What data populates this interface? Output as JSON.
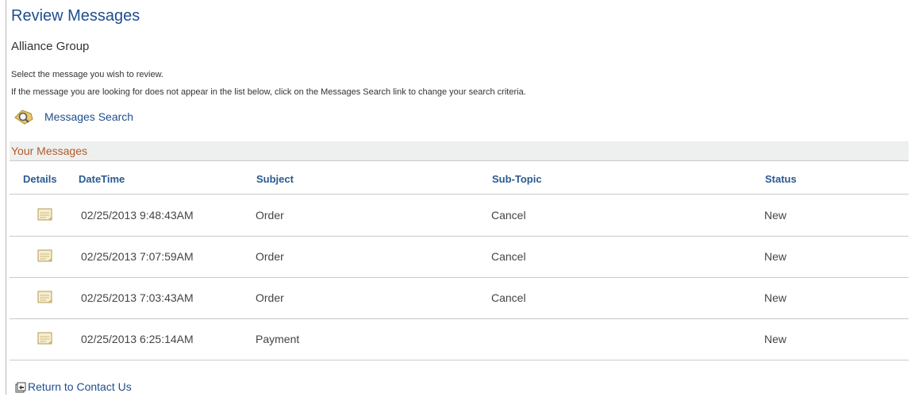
{
  "page": {
    "title": "Review Messages",
    "organization": "Alliance Group",
    "instruction_1": "Select the message you wish to review.",
    "instruction_2": "If the message you are looking for does not appear in the list below, click on the Messages Search link to change your search criteria."
  },
  "search_link": {
    "label": "Messages Search",
    "icon": "magnifier-search-icon"
  },
  "grid": {
    "title": "Your Messages",
    "columns": [
      "Details",
      "DateTime",
      "Subject",
      "Sub-Topic",
      "Status"
    ],
    "rows": [
      {
        "details_icon": "message-details-icon",
        "datetime": "02/25/2013  9:48:43AM",
        "subject": "Order",
        "sub_topic": "Cancel",
        "status": "New"
      },
      {
        "details_icon": "message-details-icon",
        "datetime": "02/25/2013  7:07:59AM",
        "subject": "Order",
        "sub_topic": "Cancel",
        "status": "New"
      },
      {
        "details_icon": "message-details-icon",
        "datetime": "02/25/2013  7:03:43AM",
        "subject": "Order",
        "sub_topic": "Cancel",
        "status": "New"
      },
      {
        "details_icon": "message-details-icon",
        "datetime": "02/25/2013  6:25:14AM",
        "subject": "Payment",
        "sub_topic": "",
        "status": "New"
      }
    ]
  },
  "return_link": {
    "label": "Return to Contact Us",
    "icon": "return-icon"
  },
  "colors": {
    "title_blue": "#1f4e8c",
    "link_blue": "#1f4e8c",
    "grid_title_orange": "#b05a2e",
    "header_blue": "#2a5a93",
    "grid_header_bg": "#eef0ef"
  }
}
